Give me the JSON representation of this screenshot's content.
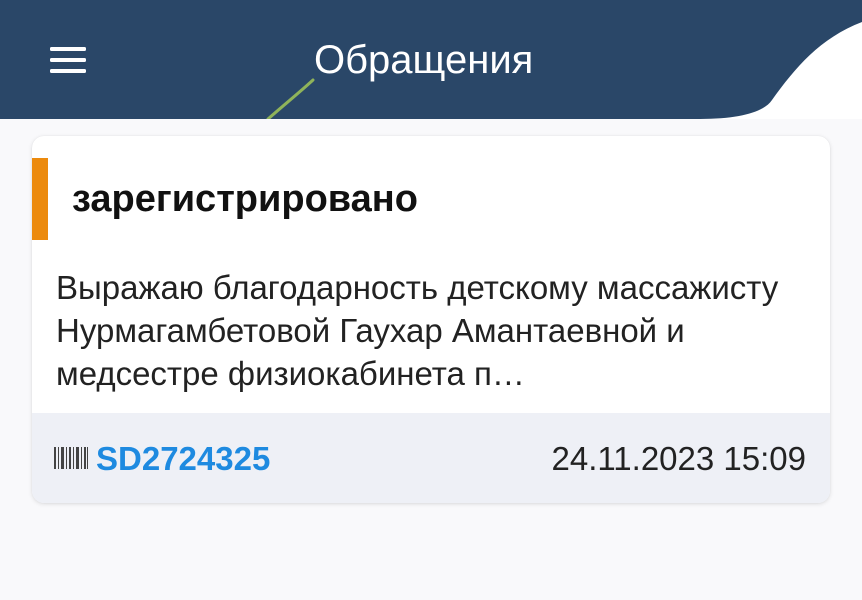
{
  "header": {
    "title": "Обращения",
    "menu_icon": "hamburger-menu-icon",
    "background_color": "#2a4768",
    "accent_color": "#8fb35a"
  },
  "tickets": [
    {
      "status": "зарегистрировано",
      "status_color": "#ec8a0d",
      "description": "Выражаю благодарность детскому массажисту Нурмагамбетовой Гаухар Амантаевной и медсестре физиокабинета п…",
      "id_icon": "barcode-icon",
      "id": "SD2724325",
      "id_color": "#1e8ae0",
      "date": "24.11.2023 15:09"
    }
  ]
}
